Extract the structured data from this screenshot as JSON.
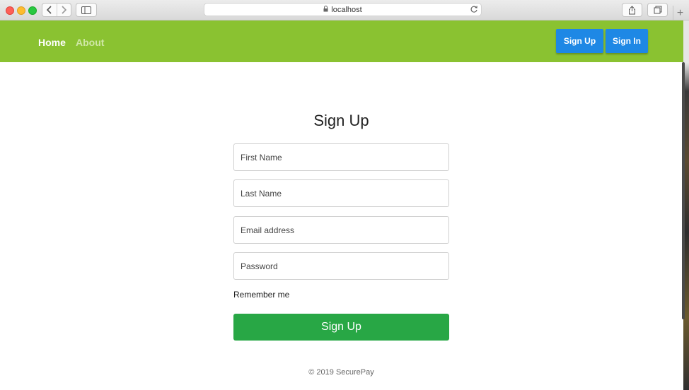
{
  "browser": {
    "url": "localhost"
  },
  "navbar": {
    "home_label": "Home",
    "about_label": "About",
    "signup_label": "Sign Up",
    "signin_label": "Sign In",
    "bg_color": "#8ac231",
    "button_color": "#1e88e5"
  },
  "form": {
    "title": "Sign Up",
    "first_name_placeholder": "First Name",
    "last_name_placeholder": "Last Name",
    "email_placeholder": "Email address",
    "password_placeholder": "Password",
    "remember_label": "Remember me",
    "submit_label": "Sign Up",
    "submit_color": "#28a745"
  },
  "footer": {
    "text": "© 2019 SecurePay"
  }
}
